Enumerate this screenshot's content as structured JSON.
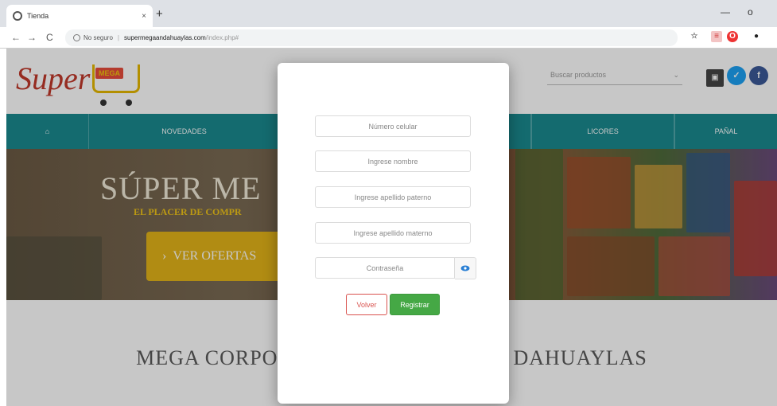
{
  "browser": {
    "tab_title": "Tienda",
    "tab_close": "×",
    "new_tab": "+",
    "nav_back": "←",
    "nav_forward": "→",
    "nav_reload": "C",
    "security_label": "No seguro",
    "url_host": "supermegaandahuaylas.com",
    "url_path": "/index.php#",
    "win_minimize": "—",
    "win_maximize": "o"
  },
  "site": {
    "logo_text": "Super",
    "logo_badge": "MEGA",
    "search_placeholder": "Buscar productos",
    "nav_items": [
      "NOVEDADES",
      "LICORES",
      "PAÑAL"
    ],
    "hero_title": "SÚPER ME",
    "hero_subtitle": "EL PLACER DE COMPR",
    "hero_button": "VER OFERTAS",
    "section_title_left": "MEGA CORPO",
    "section_title_right": "DAHUAYLAS"
  },
  "modal": {
    "phone_placeholder": "Número celular",
    "name_placeholder": "Ingrese nombre",
    "paternal_placeholder": "Ingrese apellido paterno",
    "maternal_placeholder": "Ingrese apellido materno",
    "password_placeholder": "Contraseña",
    "back_label": "Volver",
    "register_label": "Registrar"
  },
  "colors": {
    "navbar": "#1a8a8f",
    "hero_button": "#e3b419",
    "register": "#45a845",
    "back_border": "#d9534f"
  }
}
